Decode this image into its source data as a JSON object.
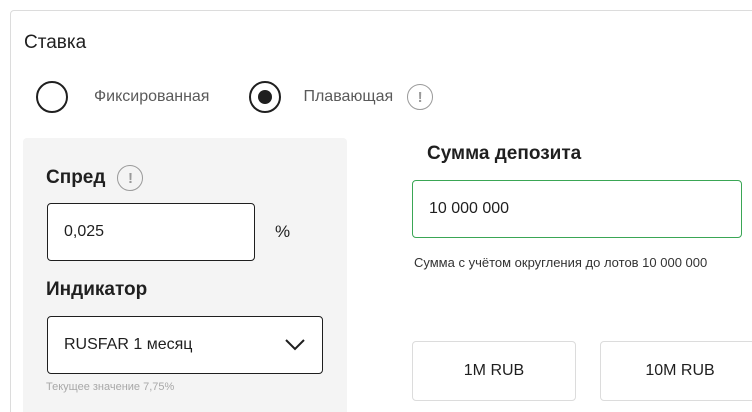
{
  "rate": {
    "title": "Ставка",
    "options": [
      {
        "label": "Фиксированная",
        "selected": false
      },
      {
        "label": "Плавающая",
        "selected": true
      }
    ],
    "info_icon": "!"
  },
  "spread": {
    "label": "Спред",
    "value": "0,025",
    "unit": "%"
  },
  "indicator": {
    "label": "Индикатор",
    "selected": "RUSFAR 1 месяц",
    "current_value_text": "Текущее значение 7,75%"
  },
  "deposit": {
    "label": "Сумма депозита",
    "value": "10 000 000",
    "note": "Сумма с учётом округления до лотов 10 000 000",
    "quick_buttons": [
      "1M RUB",
      "10M RUB"
    ]
  },
  "colors": {
    "focus_border": "#3aa655",
    "panel_bg": "#f4f4f4",
    "muted_text": "#a8a8a8"
  }
}
